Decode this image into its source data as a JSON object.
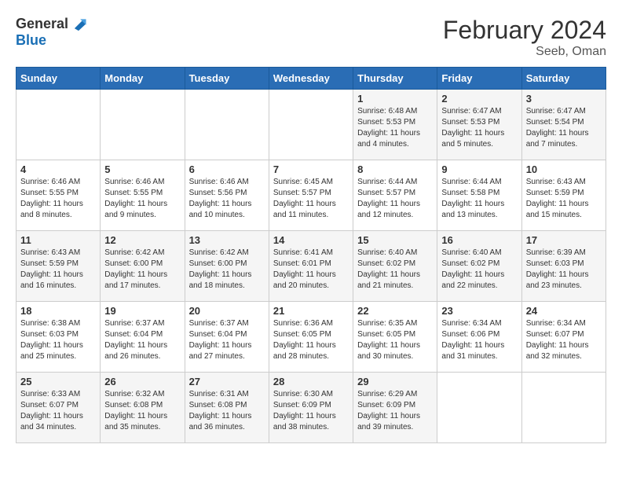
{
  "logo": {
    "general": "General",
    "blue": "Blue"
  },
  "title": {
    "month_year": "February 2024",
    "location": "Seeb, Oman"
  },
  "days_of_week": [
    "Sunday",
    "Monday",
    "Tuesday",
    "Wednesday",
    "Thursday",
    "Friday",
    "Saturday"
  ],
  "weeks": [
    [
      {
        "day": "",
        "info": ""
      },
      {
        "day": "",
        "info": ""
      },
      {
        "day": "",
        "info": ""
      },
      {
        "day": "",
        "info": ""
      },
      {
        "day": "1",
        "info": "Sunrise: 6:48 AM\nSunset: 5:53 PM\nDaylight: 11 hours\nand 4 minutes."
      },
      {
        "day": "2",
        "info": "Sunrise: 6:47 AM\nSunset: 5:53 PM\nDaylight: 11 hours\nand 5 minutes."
      },
      {
        "day": "3",
        "info": "Sunrise: 6:47 AM\nSunset: 5:54 PM\nDaylight: 11 hours\nand 7 minutes."
      }
    ],
    [
      {
        "day": "4",
        "info": "Sunrise: 6:46 AM\nSunset: 5:55 PM\nDaylight: 11 hours\nand 8 minutes."
      },
      {
        "day": "5",
        "info": "Sunrise: 6:46 AM\nSunset: 5:55 PM\nDaylight: 11 hours\nand 9 minutes."
      },
      {
        "day": "6",
        "info": "Sunrise: 6:46 AM\nSunset: 5:56 PM\nDaylight: 11 hours\nand 10 minutes."
      },
      {
        "day": "7",
        "info": "Sunrise: 6:45 AM\nSunset: 5:57 PM\nDaylight: 11 hours\nand 11 minutes."
      },
      {
        "day": "8",
        "info": "Sunrise: 6:44 AM\nSunset: 5:57 PM\nDaylight: 11 hours\nand 12 minutes."
      },
      {
        "day": "9",
        "info": "Sunrise: 6:44 AM\nSunset: 5:58 PM\nDaylight: 11 hours\nand 13 minutes."
      },
      {
        "day": "10",
        "info": "Sunrise: 6:43 AM\nSunset: 5:59 PM\nDaylight: 11 hours\nand 15 minutes."
      }
    ],
    [
      {
        "day": "11",
        "info": "Sunrise: 6:43 AM\nSunset: 5:59 PM\nDaylight: 11 hours\nand 16 minutes."
      },
      {
        "day": "12",
        "info": "Sunrise: 6:42 AM\nSunset: 6:00 PM\nDaylight: 11 hours\nand 17 minutes."
      },
      {
        "day": "13",
        "info": "Sunrise: 6:42 AM\nSunset: 6:00 PM\nDaylight: 11 hours\nand 18 minutes."
      },
      {
        "day": "14",
        "info": "Sunrise: 6:41 AM\nSunset: 6:01 PM\nDaylight: 11 hours\nand 20 minutes."
      },
      {
        "day": "15",
        "info": "Sunrise: 6:40 AM\nSunset: 6:02 PM\nDaylight: 11 hours\nand 21 minutes."
      },
      {
        "day": "16",
        "info": "Sunrise: 6:40 AM\nSunset: 6:02 PM\nDaylight: 11 hours\nand 22 minutes."
      },
      {
        "day": "17",
        "info": "Sunrise: 6:39 AM\nSunset: 6:03 PM\nDaylight: 11 hours\nand 23 minutes."
      }
    ],
    [
      {
        "day": "18",
        "info": "Sunrise: 6:38 AM\nSunset: 6:03 PM\nDaylight: 11 hours\nand 25 minutes."
      },
      {
        "day": "19",
        "info": "Sunrise: 6:37 AM\nSunset: 6:04 PM\nDaylight: 11 hours\nand 26 minutes."
      },
      {
        "day": "20",
        "info": "Sunrise: 6:37 AM\nSunset: 6:04 PM\nDaylight: 11 hours\nand 27 minutes."
      },
      {
        "day": "21",
        "info": "Sunrise: 6:36 AM\nSunset: 6:05 PM\nDaylight: 11 hours\nand 28 minutes."
      },
      {
        "day": "22",
        "info": "Sunrise: 6:35 AM\nSunset: 6:05 PM\nDaylight: 11 hours\nand 30 minutes."
      },
      {
        "day": "23",
        "info": "Sunrise: 6:34 AM\nSunset: 6:06 PM\nDaylight: 11 hours\nand 31 minutes."
      },
      {
        "day": "24",
        "info": "Sunrise: 6:34 AM\nSunset: 6:07 PM\nDaylight: 11 hours\nand 32 minutes."
      }
    ],
    [
      {
        "day": "25",
        "info": "Sunrise: 6:33 AM\nSunset: 6:07 PM\nDaylight: 11 hours\nand 34 minutes."
      },
      {
        "day": "26",
        "info": "Sunrise: 6:32 AM\nSunset: 6:08 PM\nDaylight: 11 hours\nand 35 minutes."
      },
      {
        "day": "27",
        "info": "Sunrise: 6:31 AM\nSunset: 6:08 PM\nDaylight: 11 hours\nand 36 minutes."
      },
      {
        "day": "28",
        "info": "Sunrise: 6:30 AM\nSunset: 6:09 PM\nDaylight: 11 hours\nand 38 minutes."
      },
      {
        "day": "29",
        "info": "Sunrise: 6:29 AM\nSunset: 6:09 PM\nDaylight: 11 hours\nand 39 minutes."
      },
      {
        "day": "",
        "info": ""
      },
      {
        "day": "",
        "info": ""
      }
    ]
  ]
}
